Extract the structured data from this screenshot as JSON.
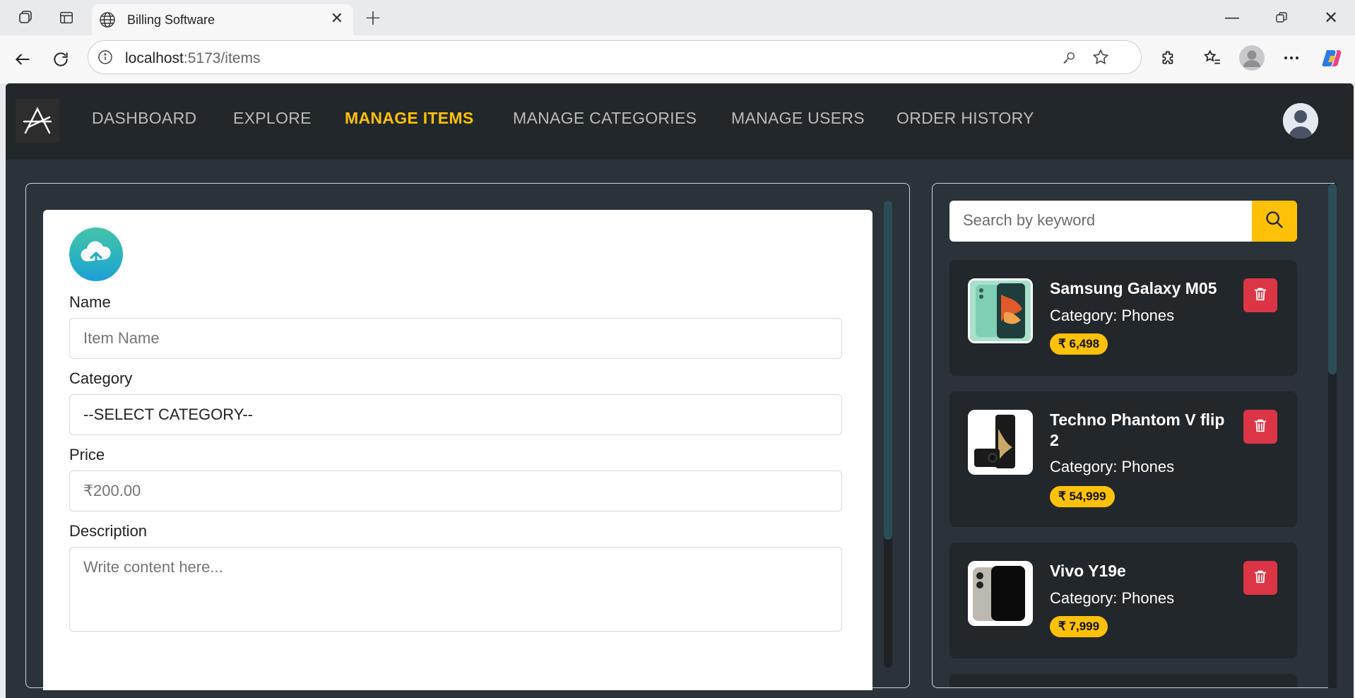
{
  "browser": {
    "tab_title": "Billing Software",
    "tab_close": "✕",
    "new_tab": "+",
    "url_host": "localhost",
    "url_path": ":5173/items",
    "minimize": "—",
    "close": "✕"
  },
  "navbar": {
    "items": [
      {
        "label": "DASHBOARD",
        "active": false
      },
      {
        "label": "EXPLORE",
        "active": false
      },
      {
        "label": "MANAGE ITEMS",
        "active": true
      },
      {
        "label": "MANAGE CATEGORIES",
        "active": false
      },
      {
        "label": "MANAGE USERS",
        "active": false
      },
      {
        "label": "ORDER HISTORY",
        "active": false
      }
    ]
  },
  "form": {
    "name_label": "Name",
    "name_placeholder": "Item Name",
    "category_label": "Category",
    "category_value": "--SELECT CATEGORY--",
    "price_label": "Price",
    "price_placeholder": "₹200.00",
    "description_label": "Description",
    "description_placeholder": "Write content here..."
  },
  "search": {
    "placeholder": "Search by keyword"
  },
  "items": [
    {
      "name": "Samsung Galaxy M05",
      "category": "Category: Phones",
      "price": "₹ 6,498"
    },
    {
      "name": "Techno Phantom V flip 2",
      "category": "Category: Phones",
      "price": "₹ 54,999"
    },
    {
      "name": "Vivo Y19e",
      "category": "Category: Phones",
      "price": "₹ 7,999"
    }
  ],
  "colors": {
    "accent": "#ffc107",
    "danger": "#dc3545",
    "navbar_bg": "#22272b",
    "page_bg": "#2a3339"
  }
}
